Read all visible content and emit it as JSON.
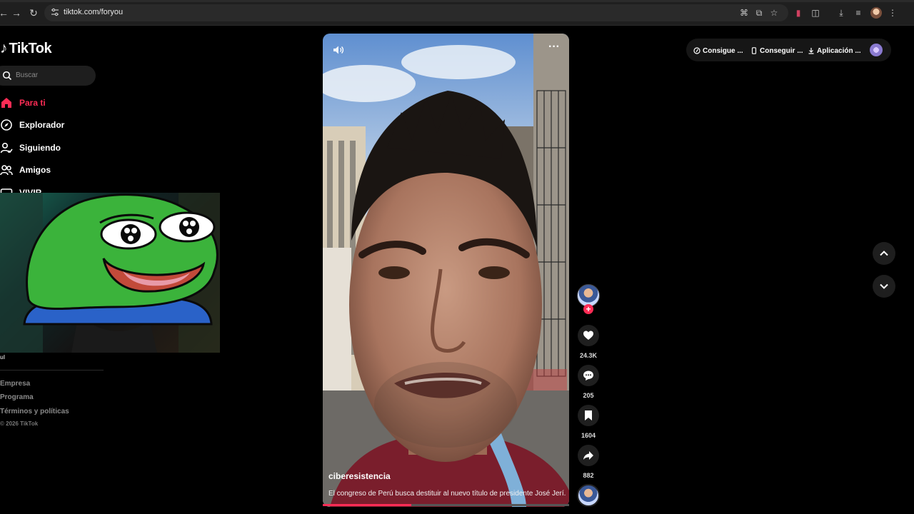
{
  "browser": {
    "url": "tiktok.com/foryou"
  },
  "app": {
    "logo_text": "TikTok",
    "search_placeholder": "Buscar",
    "accent_color": "#fe2c55"
  },
  "sidebar": {
    "items": [
      {
        "label": "Para ti",
        "icon": "home-icon",
        "active": true
      },
      {
        "label": "Explorador",
        "icon": "compass-icon",
        "active": false
      },
      {
        "label": "Siguiendo",
        "icon": "user-follow-icon",
        "active": false
      },
      {
        "label": "Amigos",
        "icon": "friends-icon",
        "active": false
      },
      {
        "label": "VIVIR",
        "icon": "live-icon",
        "active": false
      }
    ],
    "small_tag": "ul",
    "footer_links": [
      "Empresa",
      "Programa",
      "Términos y políticas"
    ],
    "copyright": "© 2026 TikTok"
  },
  "video": {
    "author": "ciberesistencia",
    "caption": "El congreso de Perú busca destituir al nuevo título de presidente José Jerí.",
    "progress": 0.36
  },
  "actions": {
    "likes": "24.3K",
    "comments": "205",
    "saves": "1604",
    "shares": "882"
  },
  "header_pills": [
    {
      "label": "Consigue ...",
      "icon": "coin-icon"
    },
    {
      "label": "Conseguir ...",
      "icon": "phone-icon"
    },
    {
      "label": "Aplicación ...",
      "icon": "download-icon"
    }
  ]
}
